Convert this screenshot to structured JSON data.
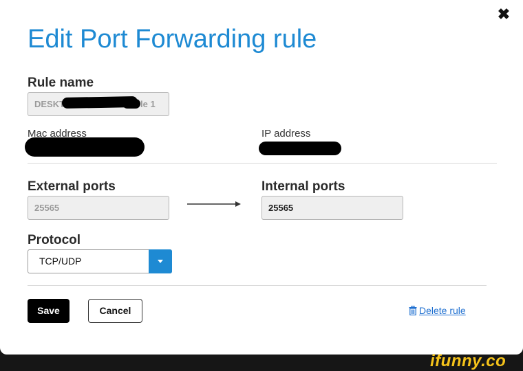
{
  "dialog": {
    "title": "Edit Port Forwarding rule",
    "close_glyph": "✖"
  },
  "rule_name": {
    "label": "Rule name",
    "value_prefix": "DESKT",
    "value_suffix": "le 1"
  },
  "mac_address": {
    "label": "Mac address"
  },
  "ip_address": {
    "label": "IP address"
  },
  "external_ports": {
    "label": "External ports",
    "value": "25565"
  },
  "internal_ports": {
    "label": "Internal ports",
    "value": "25565"
  },
  "protocol": {
    "label": "Protocol",
    "selected": "TCP/UDP"
  },
  "actions": {
    "save_label": "Save",
    "cancel_label": "Cancel",
    "delete_label": "Delete rule"
  },
  "watermark": {
    "text": "ifunny.co"
  },
  "colors": {
    "accent": "#1e8ad3",
    "link": "#1e6fd0",
    "watermark": "#f4c21a"
  }
}
